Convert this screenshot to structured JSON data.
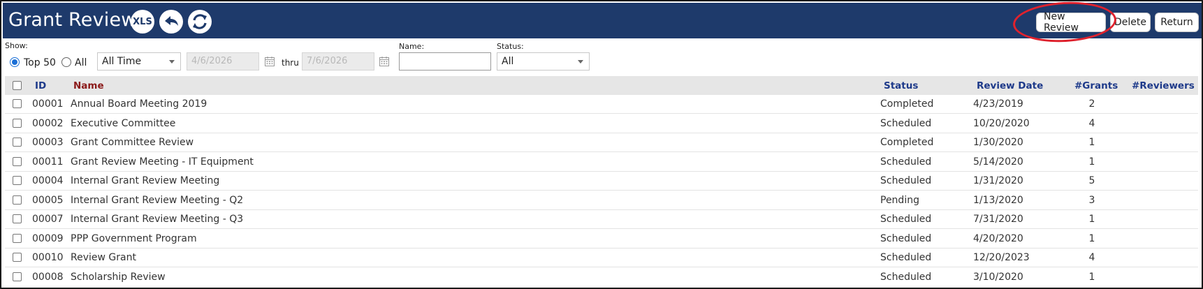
{
  "header": {
    "title": "Grant Reviews",
    "xls_label": "XLS",
    "icons": [
      "xls-icon",
      "back-arrow-icon",
      "refresh-icon"
    ],
    "buttons": {
      "new_review": "New Review",
      "delete": "Delete",
      "return": "Return"
    },
    "colors": {
      "header_bg": "#1e3a6b",
      "highlight": "#e0222d"
    }
  },
  "filters": {
    "show_label": "Show:",
    "top50_label": "Top 50",
    "all_label": "All",
    "show_selected": "Top 50",
    "period_value": "All Time",
    "date_from": "4/6/2026",
    "thru_label": "thru",
    "date_to": "7/6/2026",
    "name_label": "Name:",
    "name_value": "",
    "status_label": "Status:",
    "status_value": "All"
  },
  "table": {
    "columns": {
      "id": "ID",
      "name": "Name",
      "status": "Status",
      "review_date": "Review Date",
      "grants": "#Grants",
      "reviewers": "#Reviewers"
    },
    "rows": [
      {
        "id": "00001",
        "name": "Annual Board Meeting 2019",
        "status": "Completed",
        "review_date": "4/23/2019",
        "grants": "2",
        "reviewers": ""
      },
      {
        "id": "00002",
        "name": "Executive Committee",
        "status": "Scheduled",
        "review_date": "10/20/2020",
        "grants": "4",
        "reviewers": ""
      },
      {
        "id": "00003",
        "name": "Grant Committee Review",
        "status": "Completed",
        "review_date": "1/30/2020",
        "grants": "1",
        "reviewers": ""
      },
      {
        "id": "00011",
        "name": "Grant Review Meeting - IT Equipment",
        "status": "Scheduled",
        "review_date": "5/14/2020",
        "grants": "1",
        "reviewers": ""
      },
      {
        "id": "00004",
        "name": "Internal Grant Review Meeting",
        "status": "Scheduled",
        "review_date": "1/31/2020",
        "grants": "5",
        "reviewers": ""
      },
      {
        "id": "00005",
        "name": "Internal Grant Review Meeting - Q2",
        "status": "Pending",
        "review_date": "1/13/2020",
        "grants": "3",
        "reviewers": ""
      },
      {
        "id": "00007",
        "name": "Internal Grant Review Meeting - Q3",
        "status": "Scheduled",
        "review_date": "7/31/2020",
        "grants": "1",
        "reviewers": ""
      },
      {
        "id": "00009",
        "name": "PPP Government Program",
        "status": "Scheduled",
        "review_date": "4/20/2020",
        "grants": "1",
        "reviewers": ""
      },
      {
        "id": "00010",
        "name": "Review Grant",
        "status": "Scheduled",
        "review_date": "12/20/2023",
        "grants": "4",
        "reviewers": ""
      },
      {
        "id": "00008",
        "name": "Scholarship Review",
        "status": "Scheduled",
        "review_date": "3/10/2020",
        "grants": "1",
        "reviewers": ""
      }
    ]
  }
}
